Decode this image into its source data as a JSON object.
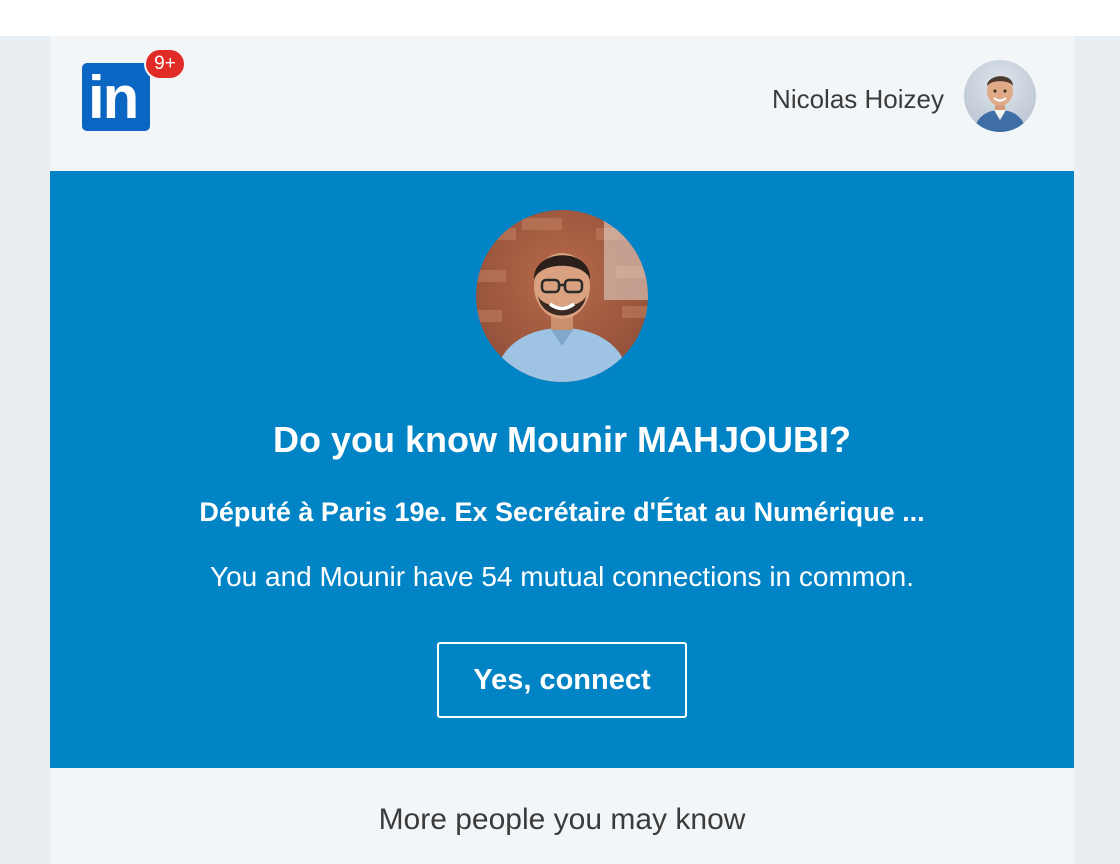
{
  "header": {
    "logo_text": "in",
    "notification_count": "9+",
    "user_name": "Nicolas Hoizey"
  },
  "suggestion": {
    "title": "Do you know Mounir MAHJOUBI?",
    "headline": "Député à Paris 19e. Ex Secrétaire d'État au Numérique ...",
    "mutual_text": "You and Mounir have 54 mutual connections in common.",
    "connect_label": "Yes, connect"
  },
  "more_section": {
    "title": "More people you may know"
  },
  "colors": {
    "brand": "#0a66c2",
    "hero_background": "#0084c6",
    "badge": "#e02b27",
    "card_background": "#f3f6f8"
  }
}
